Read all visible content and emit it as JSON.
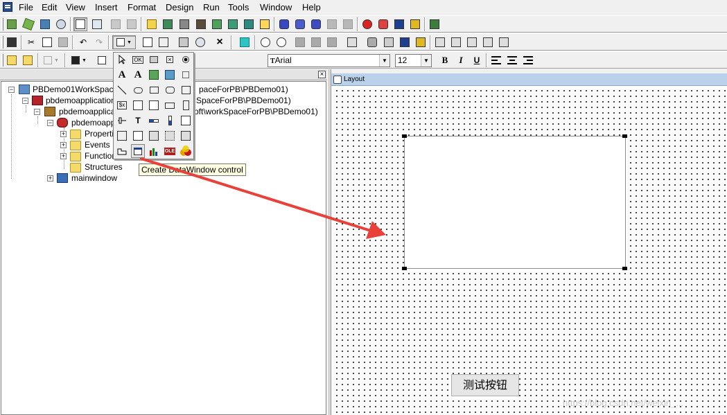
{
  "menu": [
    "File",
    "Edit",
    "View",
    "Insert",
    "Format",
    "Design",
    "Run",
    "Tools",
    "Window",
    "Help"
  ],
  "format_bar": {
    "font_name": "Arial",
    "font_size": "12",
    "bold": "B",
    "italic": "I",
    "underline": "U"
  },
  "tree": {
    "workspace": "PBDemo01WorkSpace",
    "workspace_tail": "paceForPB\\PBDemo01)",
    "target": "pbdemoapplication0",
    "target_tail": "SpaceForPB\\PBDemo01)",
    "library": "pbdemoapplicati",
    "library_tail": "oft\\workSpaceForPB\\PBDemo01)",
    "application": "pbdemoappl",
    "children": [
      "Propertie",
      "Events",
      "Functior",
      "Structures"
    ],
    "window": "mainwindow"
  },
  "layout": {
    "caption": "Layout",
    "button_label": "测试按钮",
    "watermark": "https://blog.csdn.net/weixin_..."
  },
  "palette": {
    "ok_label": "OK",
    "tooltip": "Create DataWindow control"
  },
  "colors": {
    "arrow": "#e8413a",
    "layout_caption": "#b9d1ea",
    "tooltip_bg": "#ffffe1"
  }
}
